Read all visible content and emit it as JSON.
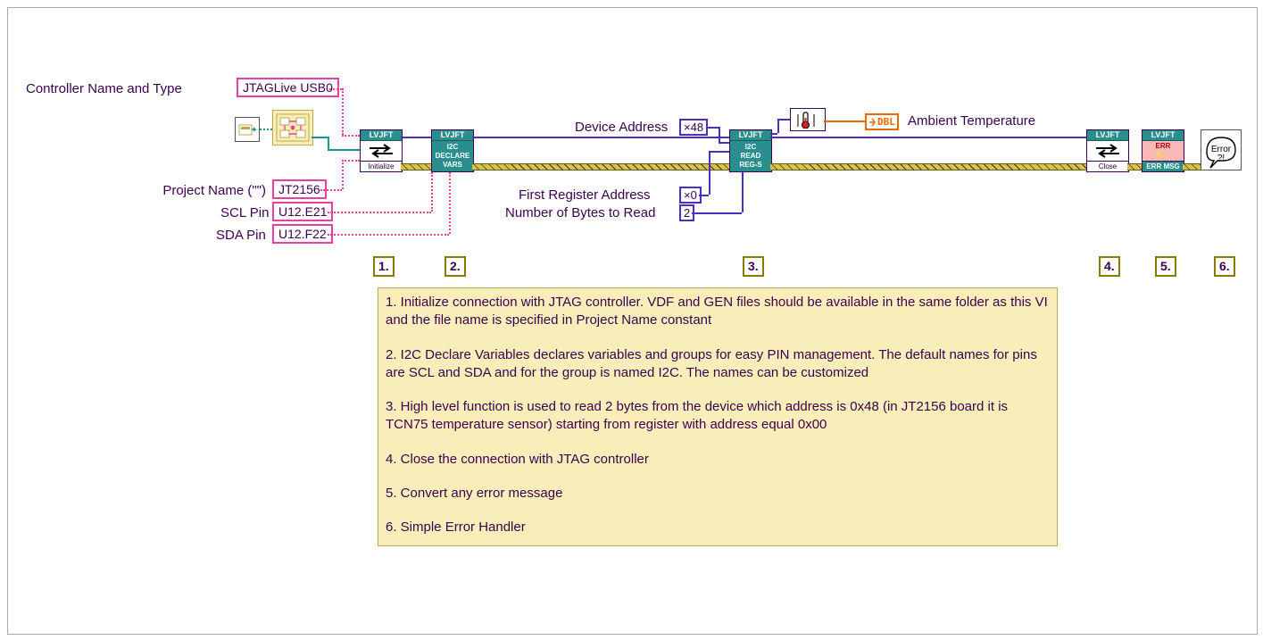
{
  "labels": {
    "ctrl_name_type": "Controller Name and Type",
    "project_name": "Project Name (\"\")",
    "scl_pin": "SCL Pin",
    "sda_pin": "SDA Pin",
    "device_addr": "Device Address",
    "first_reg_addr": "First Register Address",
    "num_bytes": "Number of Bytes to Read",
    "ambient_temp": "Ambient Temperature",
    "error_balloon": "Error"
  },
  "constants": {
    "controller": "JTAGLive USB0",
    "project": "JT2156",
    "scl": "U12.E21",
    "sda": "U12.F22",
    "dev_addr": "×48",
    "first_reg": "×0",
    "num_bytes": "2"
  },
  "vis": {
    "hdr": "LVJFT",
    "init_footer": "Initialize",
    "declare_body1": "I2C",
    "declare_body2": "DECLARE",
    "declare_body3": "VARS",
    "read_body1": "I2C",
    "read_body2": "READ",
    "read_body3": "REG-S",
    "close_footer": "Close",
    "errmsg_body": "ERR",
    "errmsg_footer": "ERR MSG"
  },
  "dbl": {
    "text": "DBL"
  },
  "steps": {
    "s1": "1.",
    "s2": "2.",
    "s3": "3.",
    "s4": "4.",
    "s5": "5.",
    "s6": "6."
  },
  "notes": {
    "n1": "1. Initialize connection with JTAG controller. VDF and GEN files should be available in the same folder as this VI and the file name is specified in Project Name constant",
    "n2": "2. I2C Declare Variables declares variables and groups for easy PIN management. The default names for pins are SCL and SDA and for the group is named I2C. The names can be customized",
    "n3": "3. High level function is used to read 2 bytes from the device which address is 0x48 (in JT2156 board it is TCN75 temperature sensor) starting from register with address equal 0x00",
    "n4": "4. Close the connection with JTAG controller",
    "n5": "5. Convert any error message",
    "n6": "6. Simple Error Handler"
  }
}
